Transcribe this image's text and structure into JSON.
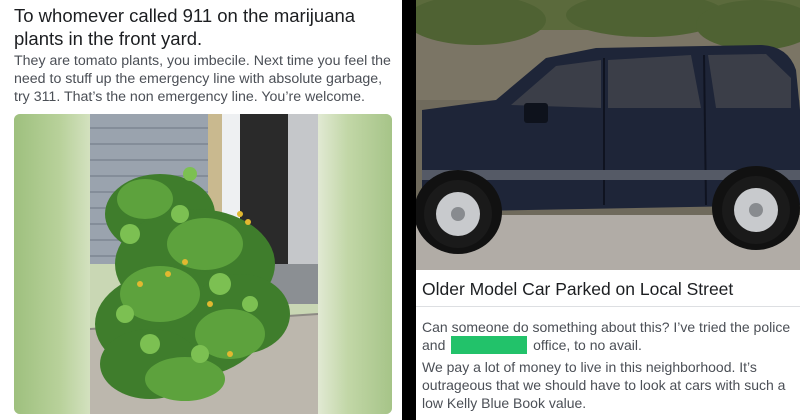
{
  "left_post": {
    "title": "To whomever called 911 on the marijuana plants in the front yard.",
    "body": "They are tomato plants, you imbecile. Next time you feel the need to stuff up the emergency line with absolute garbage, try 311. That’s the non emergency line. You’re welcome."
  },
  "right_post": {
    "title": "Older Model Car Parked on Local Street",
    "p1_before": "Can someone do something about this? I’ve tried the police and",
    "p1_after": "office, to no avail.",
    "p2": "We pay a lot of money to live in this neighborhood. It’s outrageous that we should have to look at cars with such a low Kelly Blue Book value."
  },
  "colors": {
    "divider": "#000000",
    "redaction": "#22c26a",
    "text_dark": "#1c1e21",
    "text_body": "#4b4f56"
  }
}
